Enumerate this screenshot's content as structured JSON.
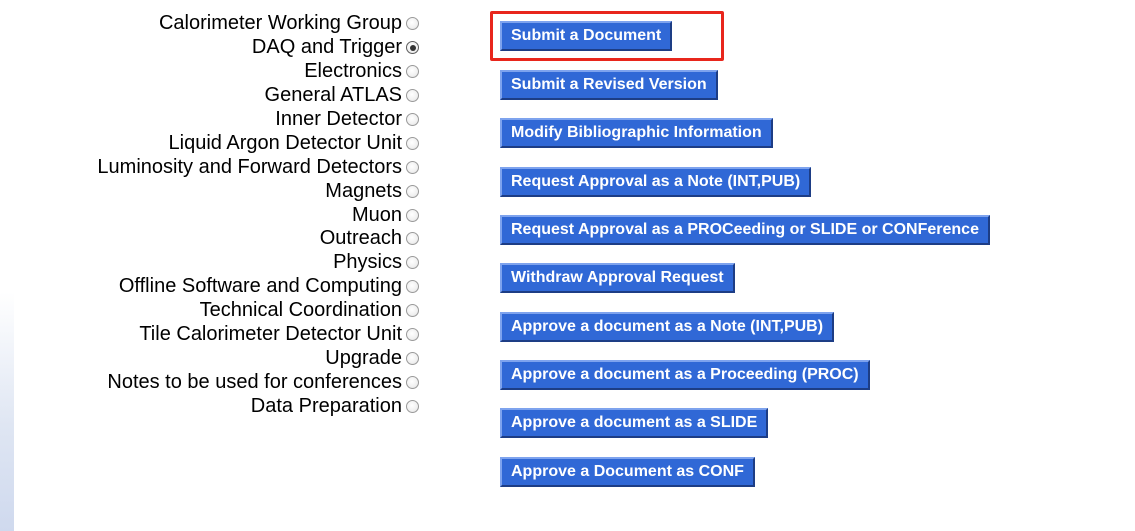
{
  "groups": [
    {
      "label": "Calorimeter Working Group",
      "selected": false
    },
    {
      "label": "DAQ and Trigger",
      "selected": true
    },
    {
      "label": "Electronics",
      "selected": false
    },
    {
      "label": "General ATLAS",
      "selected": false
    },
    {
      "label": "Inner Detector",
      "selected": false
    },
    {
      "label": "Liquid Argon Detector Unit",
      "selected": false
    },
    {
      "label": "Luminosity and Forward Detectors",
      "selected": false
    },
    {
      "label": "Magnets",
      "selected": false
    },
    {
      "label": "Muon",
      "selected": false
    },
    {
      "label": "Outreach",
      "selected": false
    },
    {
      "label": "Physics",
      "selected": false
    },
    {
      "label": "Offline Software and Computing",
      "selected": false
    },
    {
      "label": "Technical Coordination",
      "selected": false
    },
    {
      "label": "Tile Calorimeter Detector Unit",
      "selected": false
    },
    {
      "label": "Upgrade",
      "selected": false
    },
    {
      "label": "Notes to be used for conferences",
      "selected": false
    },
    {
      "label": "Data Preparation",
      "selected": false
    }
  ],
  "actions": [
    {
      "label": "Submit a Document",
      "highlighted": true
    },
    {
      "label": "Submit a Revised Version"
    },
    {
      "label": "Modify Bibliographic Information"
    },
    {
      "label": "Request Approval as a Note (INT,PUB)"
    },
    {
      "label": "Request Approval as a PROCeeding or SLIDE or CONFerence"
    },
    {
      "label": "Withdraw Approval Request"
    },
    {
      "label": "Approve a document as a Note (INT,PUB)"
    },
    {
      "label": "Approve a document as a Proceeding (PROC)"
    },
    {
      "label": "Approve a document as a SLIDE"
    },
    {
      "label": "Approve a Document as CONF"
    }
  ],
  "colors": {
    "button_bg": "#3068d6",
    "button_text": "#ffffff",
    "highlight_border": "#e8261c"
  }
}
